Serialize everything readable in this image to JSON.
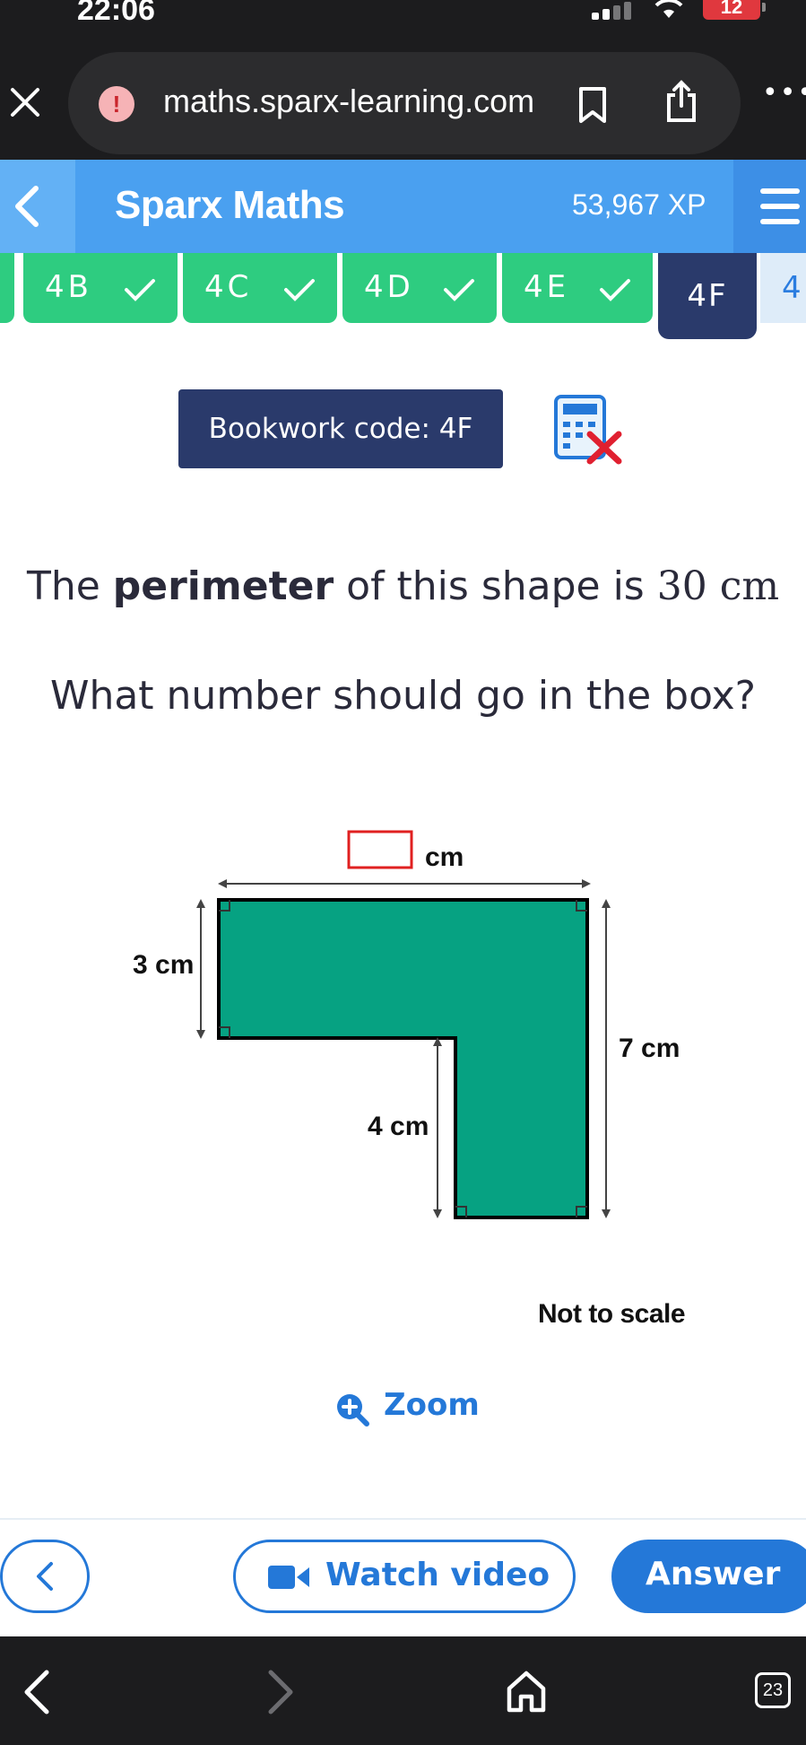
{
  "status": {
    "time": "22:06",
    "battery": "12"
  },
  "browser": {
    "url": "maths.sparx-learning.com",
    "tab_count": "23"
  },
  "header": {
    "title": "Sparx Maths",
    "xp": "53,967 XP"
  },
  "tabs": [
    {
      "label": "4B",
      "done": true
    },
    {
      "label": "4C",
      "done": true
    },
    {
      "label": "4D",
      "done": true
    },
    {
      "label": "4E",
      "done": true
    }
  ],
  "active_tab": "4F",
  "next_tab_partial": "4",
  "bookwork": "Bookwork code: 4F",
  "question": {
    "line1_pre": "The ",
    "line1_bold": "perimeter",
    "line1_mid": " of this shape is ",
    "line1_value": "30 cm",
    "line2": "What number should go in the box?"
  },
  "diagram": {
    "top_unit": "cm",
    "left_label": "3 cm",
    "right_label": "7 cm",
    "inner_label": "4 cm",
    "shape_color": "#06a282",
    "box_color": "#e02020"
  },
  "note": "Not to scale",
  "zoom_label": "Zoom",
  "buttons": {
    "watch": "Watch video",
    "answer": "Answer"
  },
  "colors": {
    "accent": "#2478d8",
    "header": "#4aa0f0",
    "tab_done": "#2ecc80",
    "tab_active": "#2a3a6b"
  }
}
